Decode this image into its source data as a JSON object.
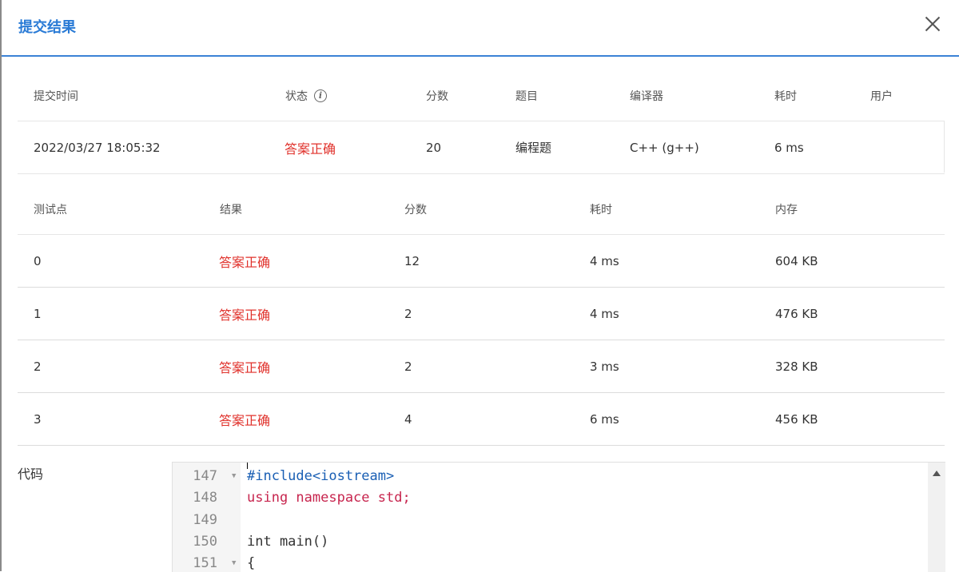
{
  "dialog": {
    "title": "提交结果"
  },
  "summary": {
    "headers": {
      "time": "提交时间",
      "status": "状态",
      "score": "分数",
      "problem": "题目",
      "compiler": "编译器",
      "elapsed": "耗时",
      "user": "用户"
    },
    "row": {
      "time": "2022/03/27 18:05:32",
      "status": "答案正确",
      "score": "20",
      "problem": "编程题",
      "compiler": "C++ (g++)",
      "elapsed": "6 ms",
      "user": ""
    }
  },
  "tests": {
    "headers": {
      "case": "测试点",
      "result": "结果",
      "score": "分数",
      "elapsed": "耗时",
      "memory": "内存"
    },
    "rows": [
      {
        "case": "0",
        "result": "答案正确",
        "score": "12",
        "elapsed": "4 ms",
        "memory": "604 KB"
      },
      {
        "case": "1",
        "result": "答案正确",
        "score": "2",
        "elapsed": "4 ms",
        "memory": "476 KB"
      },
      {
        "case": "2",
        "result": "答案正确",
        "score": "2",
        "elapsed": "3 ms",
        "memory": "328 KB"
      },
      {
        "case": "3",
        "result": "答案正确",
        "score": "4",
        "elapsed": "6 ms",
        "memory": "456 KB"
      }
    ]
  },
  "code": {
    "label": "代码",
    "lines": [
      {
        "num": "147",
        "text": "#include<iostream>"
      },
      {
        "num": "148",
        "text": "using namespace std;"
      },
      {
        "num": "149",
        "text": ""
      },
      {
        "num": "150",
        "text": "int main()"
      },
      {
        "num": "151",
        "text": "{"
      }
    ]
  },
  "colors": {
    "accent": "#2a7bd6",
    "success": "#e0312b"
  },
  "icons": {
    "close": "close-icon",
    "info": "info-icon",
    "fold": "fold-arrow-icon",
    "scroll_up": "scroll-up-icon"
  }
}
